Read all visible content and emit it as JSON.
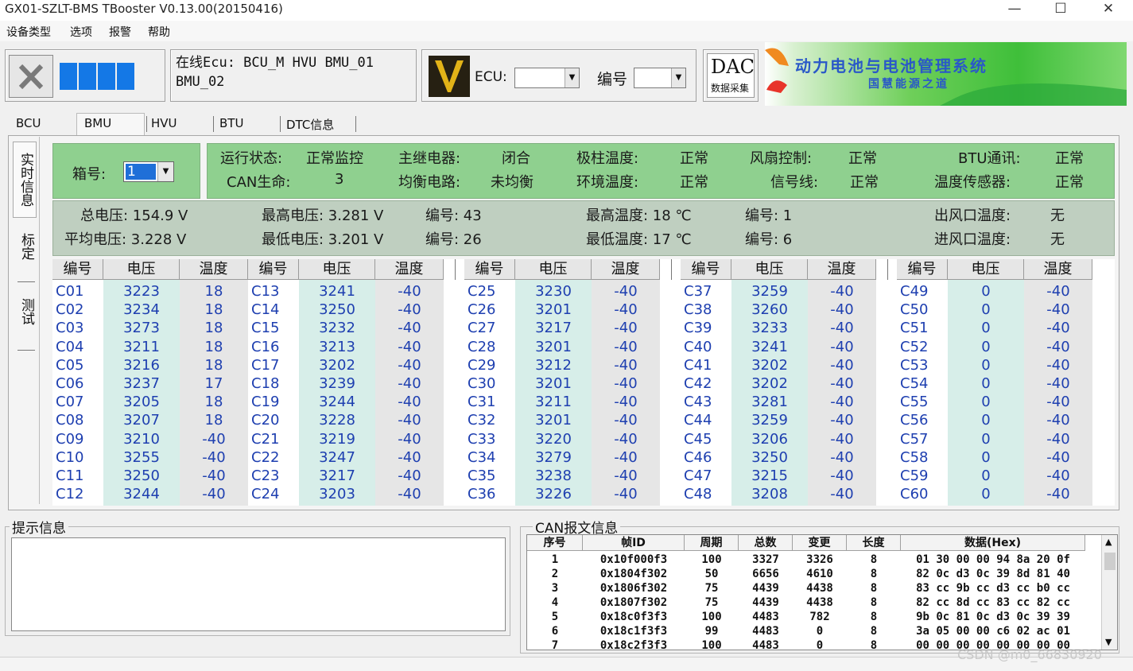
{
  "window": {
    "title": "GX01-SZLT-BMS TBooster V0.13.00(20150416)",
    "min": "—",
    "max": "☐",
    "close": "✕"
  },
  "menu": [
    "设备类型",
    "选项",
    "报警",
    "帮助"
  ],
  "toolbar": {
    "online_ecu": "在线Ecu: BCU_M HVU BMU_01 BMU_02",
    "ecu_label": "ECU:",
    "ecu_value": "",
    "num_label": "编号",
    "num_value": "",
    "dac_label": "DAC",
    "dac_sub": "数据采集",
    "banner_line1": "动力电池与电池管理系统",
    "banner_line2": "国慧能源之道"
  },
  "tabs": [
    "BCU",
    "BMU",
    "HVU",
    "BTU",
    "DTC信息"
  ],
  "active_tab": "BMU",
  "side_tabs": [
    "实时信息",
    "标定",
    "测试"
  ],
  "box": {
    "label": "箱号:",
    "value": "1"
  },
  "status": {
    "row1": [
      {
        "label": "运行状态:",
        "value": "正常监控"
      },
      {
        "label": "主继电器:",
        "value": "闭合"
      },
      {
        "label": "极柱温度:",
        "value": "正常"
      },
      {
        "label": "风扇控制:",
        "value": "正常"
      },
      {
        "label": "BTU通讯:",
        "value": "正常"
      }
    ],
    "row2": [
      {
        "label": "CAN生命:",
        "value": "3"
      },
      {
        "label": "均衡电路:",
        "value": "未均衡"
      },
      {
        "label": "环境温度:",
        "value": "正常"
      },
      {
        "label": "信号线:",
        "value": "正常"
      },
      {
        "label": "温度传感器:",
        "value": "正常"
      }
    ]
  },
  "summary": {
    "total_voltage": "总电压: 154.9 V",
    "avg_voltage": "平均电压: 3.228 V",
    "max_voltage": "最高电压: 3.281 V",
    "max_voltage_num": "编号: 43",
    "min_voltage": "最低电压: 3.201 V",
    "min_voltage_num": "编号: 26",
    "max_temp": "最高温度: 18 ℃",
    "max_temp_num": "编号: 1",
    "min_temp": "最低温度: 17 ℃",
    "min_temp_num": "编号: 6",
    "outlet_temp": "出风口温度:",
    "outlet_value": "无",
    "inlet_temp": "进风口温度:",
    "inlet_value": "无"
  },
  "cell_headers": [
    "编号",
    "电压",
    "温度"
  ],
  "cell_groups": [
    {
      "ids": [
        "C01",
        "C02",
        "C03",
        "C04",
        "C05",
        "C06",
        "C07",
        "C08",
        "C09",
        "C10",
        "C11",
        "C12"
      ],
      "v": [
        "3223",
        "3234",
        "3273",
        "3211",
        "3216",
        "3237",
        "3205",
        "3207",
        "3210",
        "3255",
        "3250",
        "3244"
      ],
      "t": [
        "18",
        "18",
        "18",
        "18",
        "18",
        "17",
        "18",
        "18",
        "-40",
        "-40",
        "-40",
        "-40"
      ]
    },
    {
      "ids": [
        "C13",
        "C14",
        "C15",
        "C16",
        "C17",
        "C18",
        "C19",
        "C20",
        "C21",
        "C22",
        "C23",
        "C24"
      ],
      "v": [
        "3241",
        "3250",
        "3232",
        "3213",
        "3202",
        "3239",
        "3244",
        "3228",
        "3219",
        "3247",
        "3217",
        "3203"
      ],
      "t": [
        "-40",
        "-40",
        "-40",
        "-40",
        "-40",
        "-40",
        "-40",
        "-40",
        "-40",
        "-40",
        "-40",
        "-40"
      ]
    },
    {
      "ids": [
        "C25",
        "C26",
        "C27",
        "C28",
        "C29",
        "C30",
        "C31",
        "C32",
        "C33",
        "C34",
        "C35",
        "C36"
      ],
      "v": [
        "3230",
        "3201",
        "3217",
        "3201",
        "3212",
        "3201",
        "3211",
        "3201",
        "3220",
        "3279",
        "3238",
        "3226"
      ],
      "t": [
        "-40",
        "-40",
        "-40",
        "-40",
        "-40",
        "-40",
        "-40",
        "-40",
        "-40",
        "-40",
        "-40",
        "-40"
      ]
    },
    {
      "ids": [
        "C37",
        "C38",
        "C39",
        "C40",
        "C41",
        "C42",
        "C43",
        "C44",
        "C45",
        "C46",
        "C47",
        "C48"
      ],
      "v": [
        "3259",
        "3260",
        "3233",
        "3241",
        "3202",
        "3202",
        "3281",
        "3259",
        "3206",
        "3250",
        "3215",
        "3208"
      ],
      "t": [
        "-40",
        "-40",
        "-40",
        "-40",
        "-40",
        "-40",
        "-40",
        "-40",
        "-40",
        "-40",
        "-40",
        "-40"
      ]
    },
    {
      "ids": [
        "C49",
        "C50",
        "C51",
        "C52",
        "C53",
        "C54",
        "C55",
        "C56",
        "C57",
        "C58",
        "C59",
        "C60"
      ],
      "v": [
        "0",
        "0",
        "0",
        "0",
        "0",
        "0",
        "0",
        "0",
        "0",
        "0",
        "0",
        "0"
      ],
      "t": [
        "-40",
        "-40",
        "-40",
        "-40",
        "-40",
        "-40",
        "-40",
        "-40",
        "-40",
        "-40",
        "-40",
        "-40"
      ]
    }
  ],
  "hint": {
    "title": "提示信息",
    "text": ""
  },
  "can": {
    "title": "CAN报文信息",
    "headers": [
      "序号",
      "帧ID",
      "周期",
      "总数",
      "变更",
      "长度",
      "数据(Hex)"
    ],
    "rows": [
      [
        "1",
        "0x10f000f3",
        "100",
        "3327",
        "3326",
        "8",
        "01 30 00 00 94 8a 20 0f"
      ],
      [
        "2",
        "0x1804f302",
        "50",
        "6656",
        "4610",
        "8",
        "82 0c d3 0c 39 8d 81 40"
      ],
      [
        "3",
        "0x1806f302",
        "75",
        "4439",
        "4438",
        "8",
        "83 cc 9b cc d3 cc b0 cc"
      ],
      [
        "4",
        "0x1807f302",
        "75",
        "4439",
        "4438",
        "8",
        "82 cc 8d cc 83 cc 82 cc"
      ],
      [
        "5",
        "0x18c0f3f3",
        "100",
        "4483",
        "782",
        "8",
        "9b 0c 81 0c d3 0c 39 39"
      ],
      [
        "6",
        "0x18c1f3f3",
        "99",
        "4483",
        "0",
        "8",
        "3a 05 00 00 c6 02 ac 01"
      ],
      [
        "7",
        "0x18c2f3f3",
        "100",
        "4483",
        "0",
        "8",
        "00 00 00 00 00 00 00 00"
      ]
    ]
  },
  "watermark": "CSDN @m0_66830920",
  "colors": {
    "green_panel": "#8fd08f",
    "gray_panel": "#bfcfc0",
    "value_blue": "#1e3fb0",
    "voltage_col_bg": "#d7eee9"
  }
}
